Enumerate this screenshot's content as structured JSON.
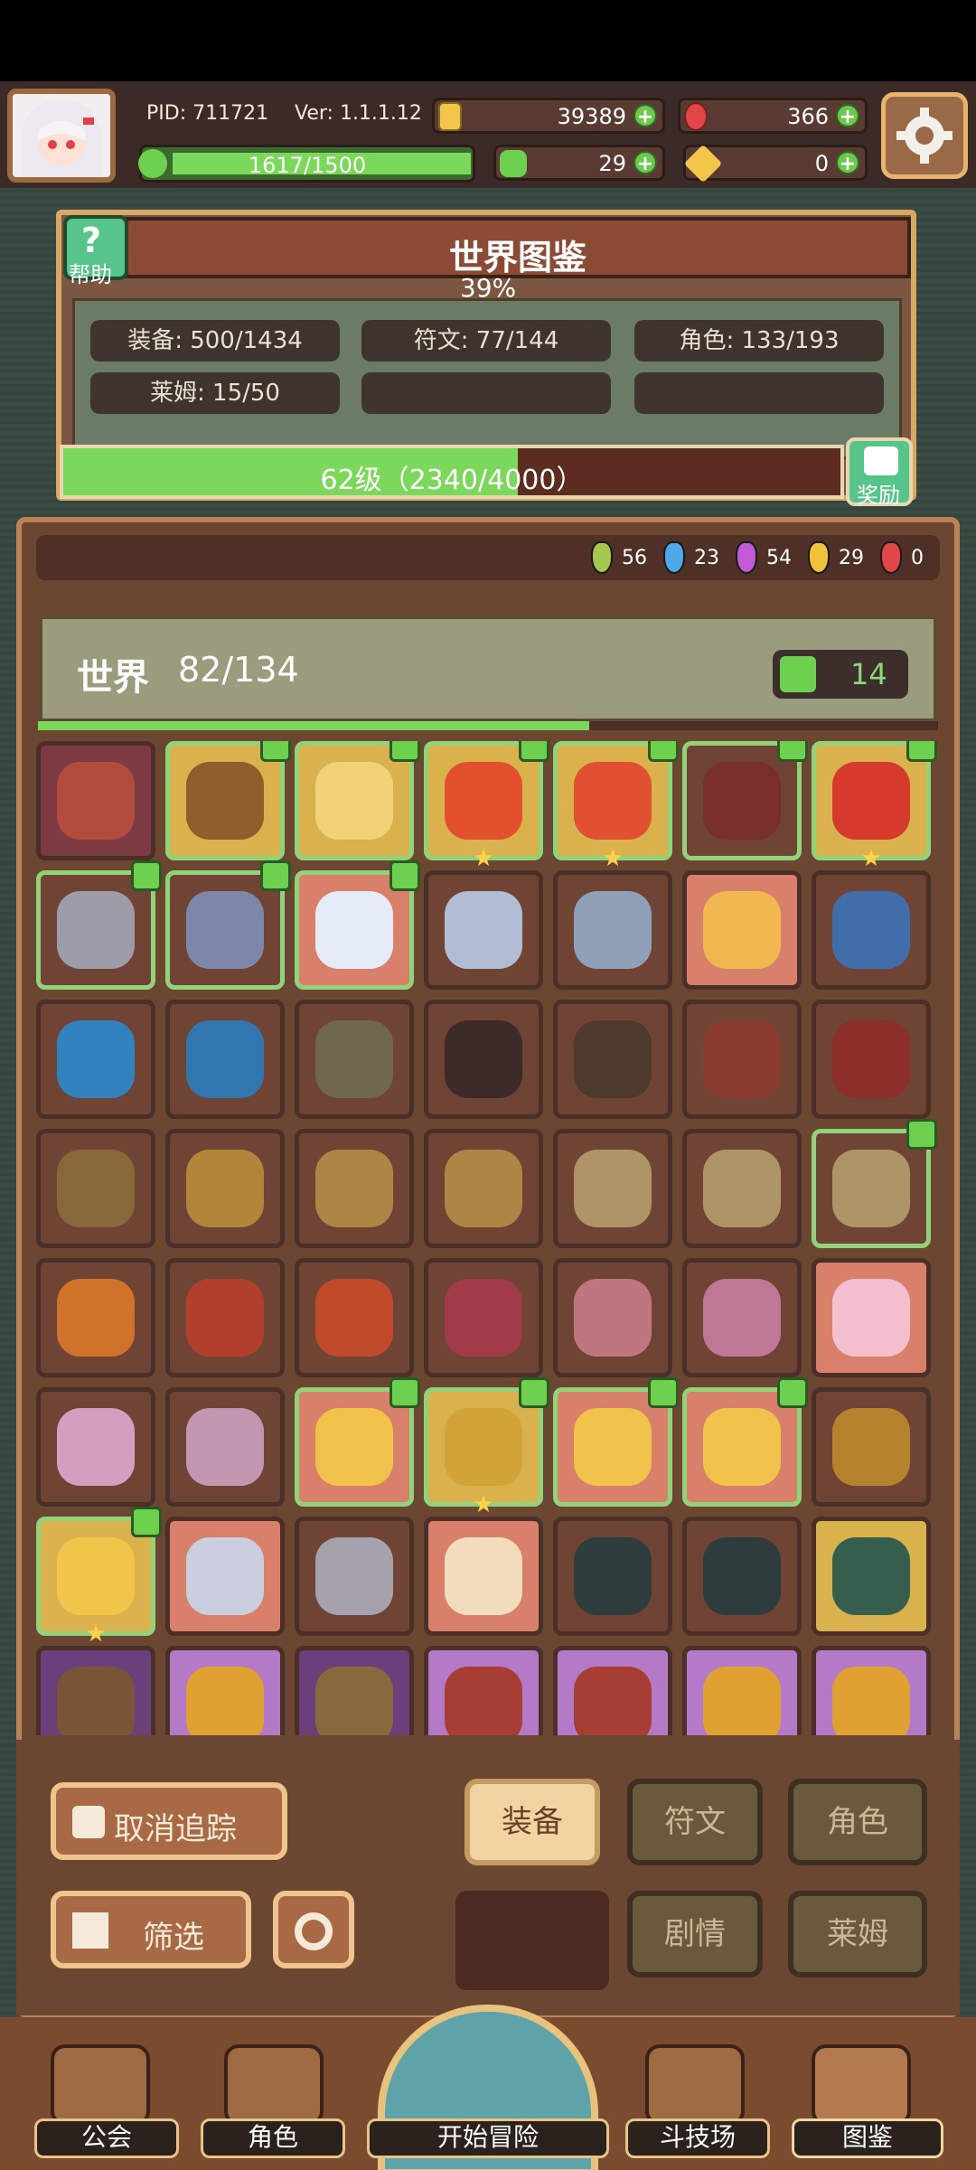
{
  "profile": {
    "pid": "PID: 711721",
    "ver": "Ver: 1.1.1.12",
    "exp": "1617/1500",
    "exp_ratio": 1.0
  },
  "currency": {
    "gold": "39389",
    "ruby": "366",
    "clover": "29",
    "key": "0"
  },
  "codex": {
    "help": "帮助",
    "title": "世界图鉴",
    "percent": "39%",
    "equip": "装备: 500/1434",
    "rune": "符文: 77/144",
    "role": "角色: 133/193",
    "slime": "莱姆: 15/50",
    "level": "62级（2340/4000）",
    "level_ratio": 0.585,
    "reward": "奖励"
  },
  "gems": [
    {
      "color": "#a6c84f",
      "count": "56"
    },
    {
      "color": "#4fa8e8",
      "count": "23"
    },
    {
      "color": "#c45bd6",
      "count": "54"
    },
    {
      "color": "#f2c23a",
      "count": "29"
    },
    {
      "color": "#e24646",
      "count": "0"
    }
  ],
  "world": {
    "label": "世界",
    "count": "82/134",
    "likes": "14",
    "progress_ratio": 0.612
  },
  "grid_items": [
    {
      "row": 0,
      "col": 0,
      "bg": "red",
      "icon": "bread-bowl-icon",
      "color": "#b54d3f",
      "thumb": false,
      "star": false
    },
    {
      "row": 0,
      "col": 1,
      "bg": "gold",
      "icon": "mace-icon",
      "color": "#8a5a2b",
      "thumb": true,
      "star": false
    },
    {
      "row": 0,
      "col": 2,
      "bg": "gold",
      "icon": "ring-icon",
      "color": "#f1d57a",
      "thumb": true,
      "star": false
    },
    {
      "row": 0,
      "col": 3,
      "bg": "gold",
      "icon": "robe-icon",
      "color": "#e44b2c",
      "thumb": true,
      "star": true
    },
    {
      "row": 0,
      "col": 4,
      "bg": "gold",
      "icon": "glove-icon",
      "color": "#e14b2f",
      "thumb": true,
      "star": true
    },
    {
      "row": 0,
      "col": 5,
      "bg": "default",
      "icon": "ring-icon",
      "color": "#7a2f2a",
      "thumb": true,
      "star": false
    },
    {
      "row": 0,
      "col": 6,
      "bg": "gold",
      "icon": "boots-icon",
      "color": "#d6342a",
      "thumb": true,
      "star": true
    },
    {
      "row": 1,
      "col": 0,
      "bg": "default",
      "icon": "sword-icon",
      "color": "#9fa1b0",
      "thumb": true,
      "star": false
    },
    {
      "row": 1,
      "col": 1,
      "bg": "default",
      "icon": "shield-icon",
      "color": "#7c8bb1",
      "thumb": true,
      "star": false
    },
    {
      "row": 1,
      "col": 2,
      "bg": "pink",
      "icon": "armor-icon",
      "color": "#e6f0ff",
      "thumb": true,
      "star": false
    },
    {
      "row": 1,
      "col": 3,
      "bg": "default",
      "icon": "helm-icon",
      "color": "#b3c4dd",
      "thumb": false,
      "star": false
    },
    {
      "row": 1,
      "col": 4,
      "bg": "default",
      "icon": "necklace-icon",
      "color": "#8fa6c1",
      "thumb": false,
      "star": false
    },
    {
      "row": 1,
      "col": 5,
      "bg": "pink",
      "icon": "ring-icon",
      "color": "#f2b94f",
      "thumb": false,
      "star": false
    },
    {
      "row": 1,
      "col": 6,
      "bg": "default",
      "icon": "staff-icon",
      "color": "#3e70b1",
      "thumb": false,
      "star": false
    },
    {
      "row": 2,
      "col": 0,
      "bg": "default",
      "icon": "orb-icon",
      "color": "#2d86c5",
      "thumb": false,
      "star": false
    },
    {
      "row": 2,
      "col": 1,
      "bg": "default",
      "icon": "cape-icon",
      "color": "#2d7ab6",
      "thumb": false,
      "star": false
    },
    {
      "row": 2,
      "col": 2,
      "bg": "default",
      "icon": "gem-icon",
      "color": "#6f6a4f",
      "thumb": false,
      "star": false
    },
    {
      "row": 2,
      "col": 3,
      "bg": "default",
      "icon": "necklace-icon",
      "color": "#3a2a2a",
      "thumb": false,
      "star": false
    },
    {
      "row": 2,
      "col": 4,
      "bg": "default",
      "icon": "pot-icon",
      "color": "#4c3a2d",
      "thumb": false,
      "star": false
    },
    {
      "row": 2,
      "col": 5,
      "bg": "default",
      "icon": "armor-icon",
      "color": "#8b3a2e",
      "thumb": false,
      "star": false
    },
    {
      "row": 2,
      "col": 6,
      "bg": "default",
      "icon": "ring-icon",
      "color": "#8e2d2a",
      "thumb": false,
      "star": false
    },
    {
      "row": 3,
      "col": 0,
      "bg": "default",
      "icon": "pot-icon",
      "color": "#8a6b3b",
      "thumb": false,
      "star": false
    },
    {
      "row": 3,
      "col": 1,
      "bg": "default",
      "icon": "crown-icon",
      "color": "#b48a3b",
      "thumb": false,
      "star": false
    },
    {
      "row": 3,
      "col": 2,
      "bg": "default",
      "icon": "gem-icon",
      "color": "#b08a48",
      "thumb": false,
      "star": false
    },
    {
      "row": 3,
      "col": 3,
      "bg": "default",
      "icon": "necklace-icon",
      "color": "#b08a48",
      "thumb": false,
      "star": false
    },
    {
      "row": 3,
      "col": 4,
      "bg": "default",
      "icon": "bow-icon",
      "color": "#b09a6b",
      "thumb": false,
      "star": false
    },
    {
      "row": 3,
      "col": 5,
      "bg": "default",
      "icon": "arrow-icon",
      "color": "#b09a6b",
      "thumb": false,
      "star": false
    },
    {
      "row": 3,
      "col": 6,
      "bg": "default",
      "icon": "ring-icon",
      "color": "#b09a6b",
      "thumb": true,
      "star": false
    },
    {
      "row": 4,
      "col": 0,
      "bg": "default",
      "icon": "gem-icon",
      "color": "#d6752b",
      "thumb": false,
      "star": false
    },
    {
      "row": 4,
      "col": 1,
      "bg": "default",
      "icon": "necklace-icon",
      "color": "#b3402c",
      "thumb": false,
      "star": false
    },
    {
      "row": 4,
      "col": 2,
      "bg": "default",
      "icon": "ring-icon",
      "color": "#c44b2a",
      "thumb": false,
      "star": false
    },
    {
      "row": 4,
      "col": 3,
      "bg": "default",
      "icon": "bear-icon",
      "color": "#a33b4b",
      "thumb": false,
      "star": false
    },
    {
      "row": 4,
      "col": 4,
      "bg": "default",
      "icon": "pig-icon",
      "color": "#c27a86",
      "thumb": false,
      "star": false
    },
    {
      "row": 4,
      "col": 5,
      "bg": "default",
      "icon": "dress-icon",
      "color": "#c27a9b",
      "thumb": false,
      "star": false
    },
    {
      "row": 4,
      "col": 6,
      "bg": "pink",
      "icon": "heart-wings-icon",
      "color": "#f6c3d6",
      "thumb": false,
      "star": false
    },
    {
      "row": 5,
      "col": 0,
      "bg": "default",
      "icon": "heart-necklace-icon",
      "color": "#d9a3c9",
      "thumb": false,
      "star": false
    },
    {
      "row": 5,
      "col": 1,
      "bg": "default",
      "icon": "heart-ring-icon",
      "color": "#c79bb9",
      "thumb": false,
      "star": false
    },
    {
      "row": 5,
      "col": 2,
      "bg": "pink",
      "icon": "bone-icon",
      "color": "#f2c64a",
      "thumb": true,
      "star": false
    },
    {
      "row": 5,
      "col": 3,
      "bg": "gold",
      "icon": "ring-icon",
      "color": "#d2a337",
      "thumb": true,
      "star": true
    },
    {
      "row": 5,
      "col": 4,
      "bg": "pink",
      "icon": "boots-icon",
      "color": "#f2c64a",
      "thumb": true,
      "star": false
    },
    {
      "row": 5,
      "col": 5,
      "bg": "pink",
      "icon": "gem-icon",
      "color": "#f2c64a",
      "thumb": true,
      "star": false
    },
    {
      "row": 5,
      "col": 6,
      "bg": "default",
      "icon": "necklace-icon",
      "color": "#b9862e",
      "thumb": false,
      "star": false
    },
    {
      "row": 6,
      "col": 0,
      "bg": "gold",
      "icon": "ring-icon",
      "color": "#f2c64a",
      "thumb": true,
      "star": true
    },
    {
      "row": 6,
      "col": 1,
      "bg": "pink",
      "icon": "crossed-swords-icon",
      "color": "#c9d2e6",
      "thumb": false,
      "star": false
    },
    {
      "row": 6,
      "col": 2,
      "bg": "default",
      "icon": "crossed-swords-icon",
      "color": "#a8a8b5",
      "thumb": false,
      "star": false
    },
    {
      "row": 6,
      "col": 3,
      "bg": "pink",
      "icon": "gem-icon",
      "color": "#f2e1c0",
      "thumb": false,
      "star": false
    },
    {
      "row": 6,
      "col": 4,
      "bg": "default",
      "icon": "glove-icon",
      "color": "#2c3d3f",
      "thumb": false,
      "star": false
    },
    {
      "row": 6,
      "col": 5,
      "bg": "default",
      "icon": "ring-icon",
      "color": "#2a3c3e",
      "thumb": false,
      "star": false
    },
    {
      "row": 6,
      "col": 6,
      "bg": "gold",
      "icon": "boots-icon",
      "color": "#2d5a4d",
      "thumb": false,
      "star": false
    },
    {
      "row": 7,
      "col": 0,
      "bg": "purple",
      "icon": "sword-icon",
      "color": "#7b5534",
      "thumb": false,
      "star": false
    },
    {
      "row": 7,
      "col": 1,
      "bg": "lav",
      "icon": "sword-icon",
      "color": "#e2a42a",
      "thumb": false,
      "star": false
    },
    {
      "row": 7,
      "col": 2,
      "bg": "purple",
      "icon": "shield-icon",
      "color": "#8a6b3b",
      "thumb": false,
      "star": false
    },
    {
      "row": 7,
      "col": 3,
      "bg": "lav",
      "icon": "helm-icon",
      "color": "#a73b2b",
      "thumb": false,
      "star": false
    },
    {
      "row": 7,
      "col": 4,
      "bg": "lav",
      "icon": "armor-icon",
      "color": "#a73b2b",
      "thumb": false,
      "star": false
    },
    {
      "row": 7,
      "col": 5,
      "bg": "lav",
      "icon": "heart-necklace-icon",
      "color": "#e2a42a",
      "thumb": false,
      "star": false
    },
    {
      "row": 7,
      "col": 6,
      "bg": "lav",
      "icon": "glove-icon",
      "color": "#e2a42a",
      "thumb": false,
      "star": false
    }
  ],
  "controls": {
    "untrack": "取消追踪",
    "filter": "筛选",
    "tab_equip": "装备",
    "tab_rune": "符文",
    "tab_role": "角色",
    "tab_story": "剧情",
    "tab_slime": "莱姆"
  },
  "nav": {
    "guild": "公会",
    "role": "角色",
    "adventure": "开始冒险",
    "arena": "斗技场",
    "codex": "图鉴"
  }
}
